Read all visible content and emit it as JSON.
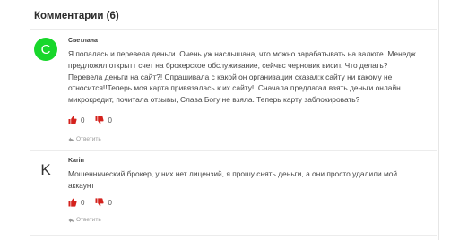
{
  "section": {
    "title": "Комментарии (6)"
  },
  "comments": [
    {
      "avatar_letter": "С",
      "author": "Светлана",
      "text_lines": [
        "Я попалась и перевела деньги. Очень уж наслышана, что можно зарабатывать на валюте. Менедж",
        "предложил открытт счет на брокерское обслуживание, сейчвс черновик висит. Что делать?",
        "Перевела деньги на сайт?! Спрашивала с какой он организации сказал:к сайту ни какому не",
        "относится!!Теперь моя карта привязалась к их сайту!! Сначала предлагал взять деньги онлайн",
        "микрокредит, почитала отзывы, Слава Богу не взяла. Теперь карту заблокировать?"
      ],
      "likes": "0",
      "dislikes": "0",
      "reply_label": "Ответить"
    },
    {
      "avatar_letter": "K",
      "author": "Karin",
      "text_lines": [
        "Мошеннический брокер, у них нет лицензий, я прошу снять деньги, а они просто удалили мой",
        "аккаунт"
      ],
      "likes": "0",
      "dislikes": "0",
      "reply_label": "Ответить"
    }
  ],
  "colors": {
    "avatar_green": "#18d72b",
    "vote_red": "#d4221d"
  },
  "icons": {
    "like": "thumbs-up-icon",
    "dislike": "thumbs-down-icon",
    "reply": "reply-arrow-icon"
  }
}
